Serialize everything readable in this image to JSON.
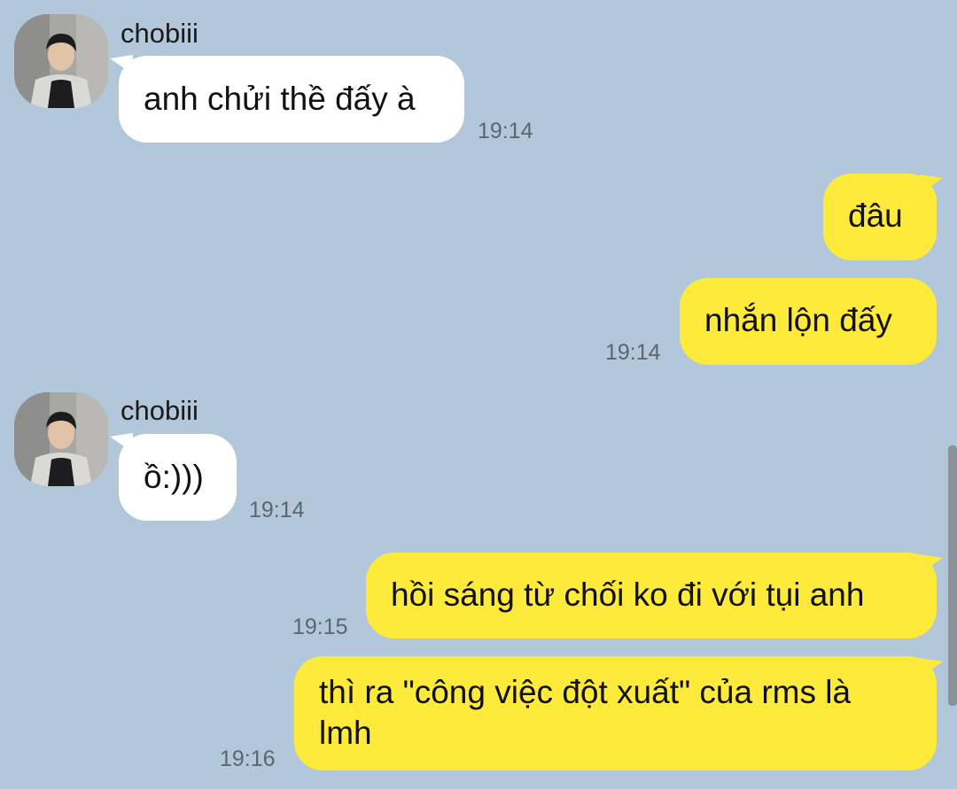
{
  "chat": {
    "messages": [
      {
        "sender": "chobiii",
        "direction": "incoming",
        "text": "anh chửi thề đấy à",
        "time": "19:14"
      },
      {
        "direction": "outgoing",
        "text": "đâu",
        "time": ""
      },
      {
        "direction": "outgoing",
        "text": "nhắn lộn đấy",
        "time": "19:14"
      },
      {
        "sender": "chobiii",
        "direction": "incoming",
        "text": "ồ:)))",
        "time": "19:14"
      },
      {
        "direction": "outgoing",
        "text": "hồi sáng từ chối ko đi với tụi anh",
        "time": "19:15"
      },
      {
        "direction": "outgoing",
        "text_line1": "thì ra \"công việc đột xuất\" của rms là",
        "text_line2": "lmh",
        "time": "19:16"
      }
    ]
  },
  "colors": {
    "background": "#b2c7d9",
    "incoming_bubble": "#ffffff",
    "outgoing_bubble": "#fdea3a",
    "timestamp": "#5b6670"
  },
  "icons": {
    "avatar": "profile-photo"
  }
}
